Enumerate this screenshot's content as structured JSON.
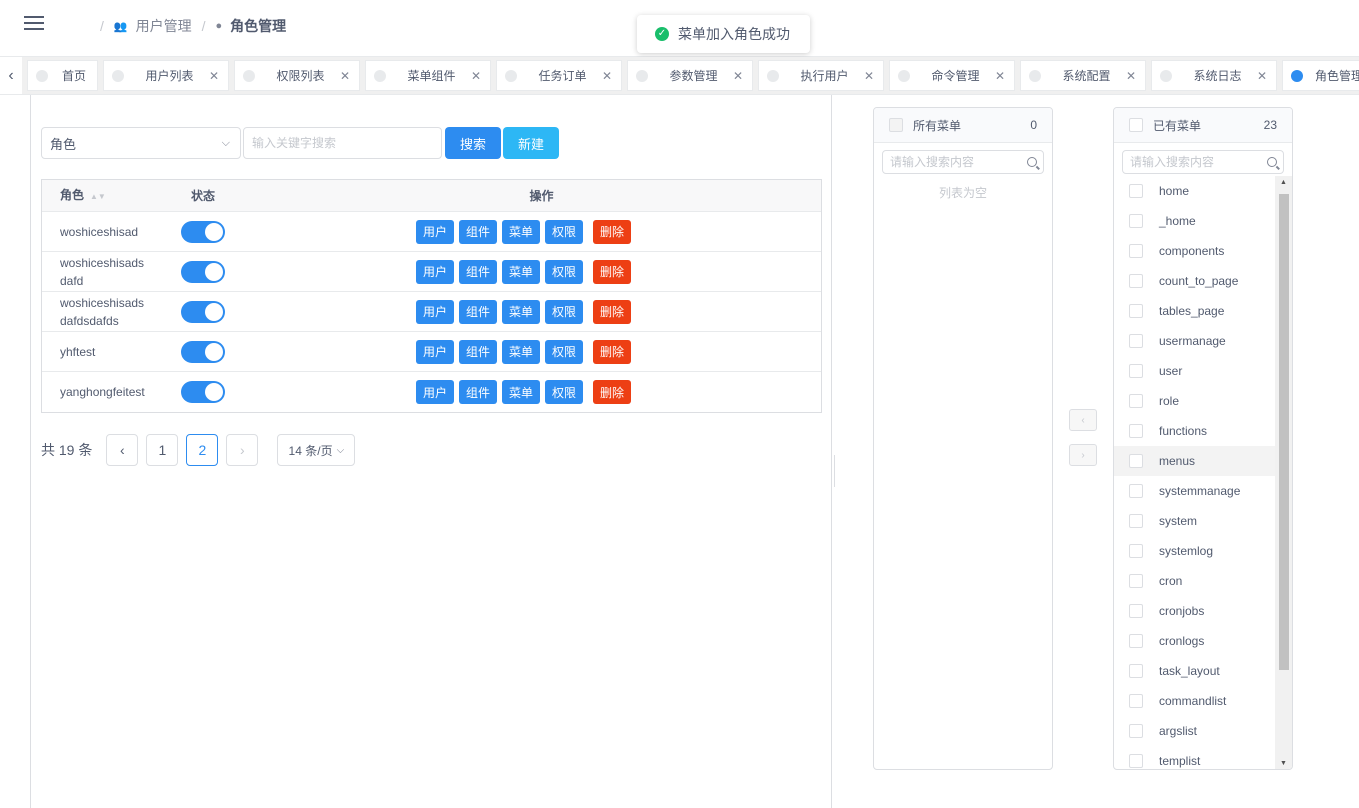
{
  "header": {
    "breadcrumb": [
      {
        "label": "用户管理",
        "icon": "users-icon"
      },
      {
        "label": "角色管理",
        "icon": "user-icon"
      }
    ]
  },
  "toast": {
    "message": "菜单加入角色成功",
    "status_color": "#19be6b"
  },
  "tabs": [
    {
      "label": "首页",
      "closable": false,
      "active": false
    },
    {
      "label": "用户列表",
      "closable": true,
      "active": false
    },
    {
      "label": "权限列表",
      "closable": true,
      "active": false
    },
    {
      "label": "菜单组件",
      "closable": true,
      "active": false
    },
    {
      "label": "任务订单",
      "closable": true,
      "active": false
    },
    {
      "label": "参数管理",
      "closable": true,
      "active": false
    },
    {
      "label": "执行用户",
      "closable": true,
      "active": false
    },
    {
      "label": "命令管理",
      "closable": true,
      "active": false
    },
    {
      "label": "系统配置",
      "closable": true,
      "active": false
    },
    {
      "label": "系统日志",
      "closable": true,
      "active": false
    },
    {
      "label": "角色管理",
      "closable": false,
      "active": true
    }
  ],
  "search": {
    "select_value": "角色",
    "keyword_placeholder": "输入关键字搜索",
    "search_label": "搜索",
    "new_label": "新建"
  },
  "table": {
    "columns": {
      "role": "角色",
      "status": "状态",
      "ops": "操作"
    },
    "action_labels": {
      "user": "用户",
      "component": "组件",
      "menu": "菜单",
      "perm": "权限",
      "delete": "删除"
    },
    "rows": [
      {
        "role": "woshiceshisad",
        "enabled": true
      },
      {
        "role": "woshiceshisads dafd",
        "enabled": true
      },
      {
        "role": "woshiceshisads dafdsdafds",
        "enabled": true
      },
      {
        "role": "yhftest",
        "enabled": true
      },
      {
        "role": "yanghongfeitest",
        "enabled": true
      }
    ]
  },
  "pagination": {
    "total_text": "共 19 条",
    "pages": [
      "1",
      "2"
    ],
    "current": "2",
    "page_size": "14 条/页"
  },
  "transfer": {
    "source": {
      "title": "所有菜单",
      "count": "0",
      "placeholder": "请输入搜索内容",
      "empty_text": "列表为空"
    },
    "target": {
      "title": "已有菜单",
      "count": "23",
      "placeholder": "请输入搜索内容",
      "items": [
        "home",
        "_home",
        "components",
        "count_to_page",
        "tables_page",
        "usermanage",
        "user",
        "role",
        "functions",
        "menus",
        "systemmanage",
        "system",
        "systemlog",
        "cron",
        "cronjobs",
        "cronlogs",
        "task_layout",
        "commandlist",
        "argslist",
        "templist"
      ]
    }
  }
}
